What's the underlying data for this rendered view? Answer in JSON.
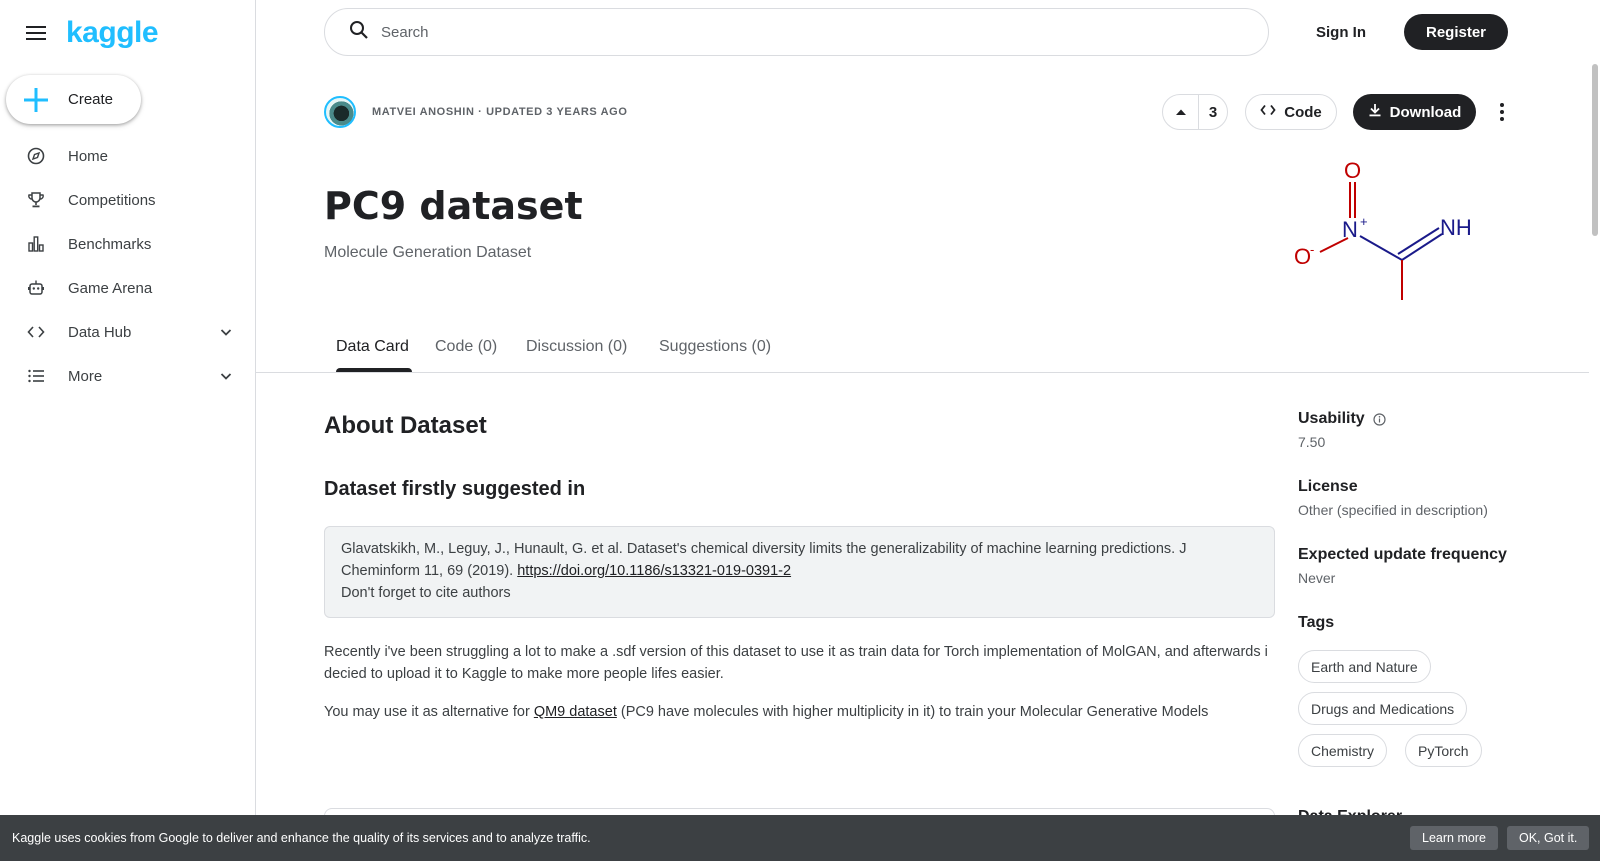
{
  "brand": {
    "logo_text": "kaggle",
    "accent": "#20beff"
  },
  "sidebar": {
    "create_label": "Create",
    "items": [
      {
        "label": "Home",
        "icon": "compass-icon"
      },
      {
        "label": "Competitions",
        "icon": "trophy-icon"
      },
      {
        "label": "Benchmarks",
        "icon": "bar-chart-icon"
      },
      {
        "label": "Game Arena",
        "icon": "robot-icon"
      },
      {
        "label": "Data Hub",
        "icon": "code-icon",
        "expandable": true
      },
      {
        "label": "More",
        "icon": "list-icon",
        "expandable": true
      }
    ]
  },
  "header": {
    "search_placeholder": "Search",
    "signin_label": "Sign In",
    "register_label": "Register"
  },
  "dataset": {
    "author_meta": "MATVEI ANOSHIN · UPDATED 3 YEARS AGO",
    "vote_count": "3",
    "code_label": "Code",
    "download_label": "Download",
    "title": "PC9 dataset",
    "subtitle": "Molecule Generation Dataset",
    "molecule_labels": {
      "o_top": "O",
      "n_plus": "N",
      "plus": "+",
      "nh": "NH",
      "o_minus": "O",
      "minus": "-"
    }
  },
  "tabs": [
    {
      "label": "Data Card",
      "active": true
    },
    {
      "label": "Code (0)"
    },
    {
      "label": "Discussion (0)"
    },
    {
      "label": "Suggestions (0)"
    }
  ],
  "content": {
    "about_heading": "About Dataset",
    "subheading": "Dataset firstly suggested in",
    "citation_text": "Glavatskikh, M., Leguy, J., Hunault, G. et al. Dataset's chemical diversity limits the generalizability of machine learning predictions. J Cheminform 11, 69 (2019). ",
    "citation_link": "https://doi.org/10.1186/s13321-019-0391-2",
    "citation_note": "Don't forget to cite authors",
    "para1": "Recently i've been struggling a lot to make a .sdf version of this dataset to use it as train data for Torch implementation of MolGAN, and afterwards i decied to upload it to Kaggle to make more people lifes easier.",
    "para2_pre": "You may use it as alternative for ",
    "para2_link": "QM9 dataset",
    "para2_post": " (PC9 have molecules with higher multiplicity in it) to train your Molecular Generative Models"
  },
  "meta": {
    "usability_label": "Usability",
    "usability_value": "7.50",
    "license_label": "License",
    "license_value": "Other (specified in description)",
    "frequency_label": "Expected update frequency",
    "frequency_value": "Never",
    "tags_label": "Tags",
    "tags": [
      "Earth and Nature",
      "Drugs and Medications",
      "Chemistry",
      "PyTorch"
    ],
    "next_label": "Data Explorer"
  },
  "cookie": {
    "message": "Kaggle uses cookies from Google to deliver and enhance the quality of its services and to analyze traffic.",
    "learn_more": "Learn more",
    "ok": "OK, Got it."
  }
}
